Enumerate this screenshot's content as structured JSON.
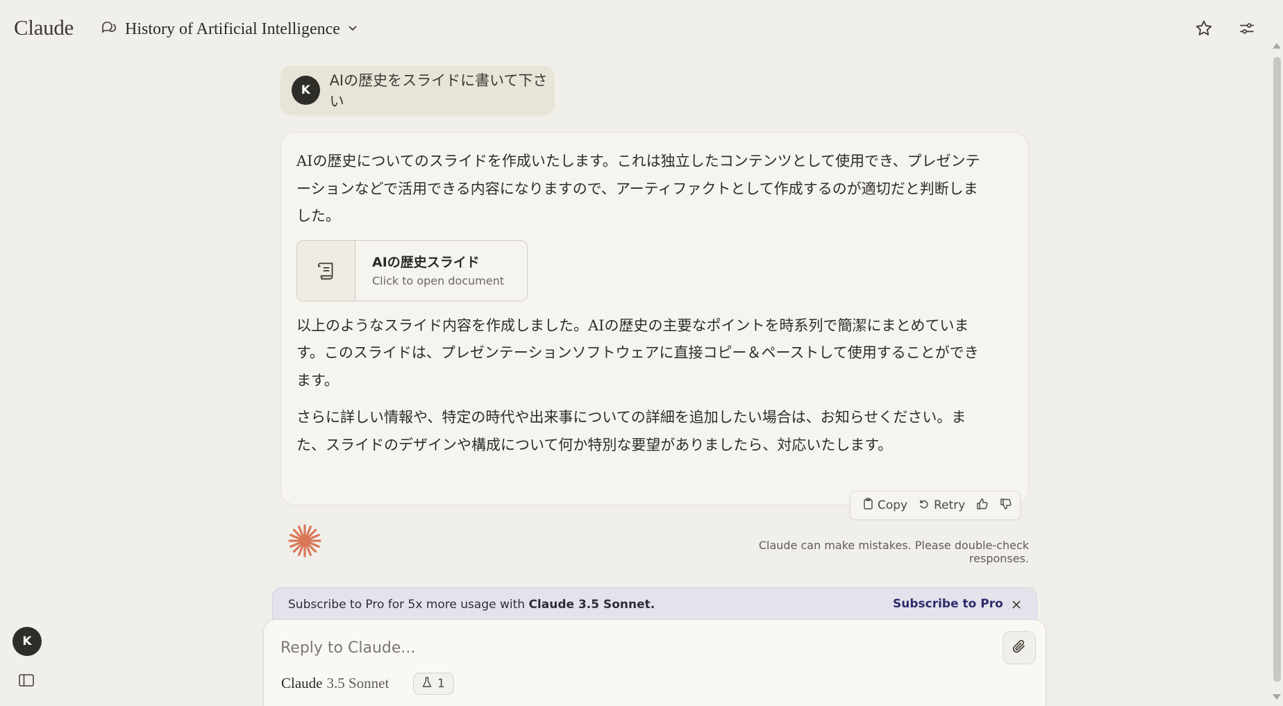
{
  "header": {
    "logo": "Claude",
    "chat_title": "History of Artificial Intelligence",
    "icons": [
      "chat-bubbles-icon",
      "chevron-down-icon",
      "star-icon",
      "sliders-icon"
    ]
  },
  "user_message": {
    "avatar_initial": "K",
    "text": "AIの歴史をスライドに書いて下さい"
  },
  "assistant_message": {
    "paragraph1": "AIの歴史についてのスライドを作成いたします。これは独立したコンテンツとして使用でき、プレゼンテーションなどで活用できる内容になりますので、アーティファクトとして作成するのが適切だと判断しました。",
    "artifact": {
      "title": "AIの歴史スライド",
      "subtitle": "Click to open document"
    },
    "paragraph2": "以上のようなスライド内容を作成しました。AIの歴史の主要なポイントを時系列で簡潔にまとめています。このスライドは、プレゼンテーションソフトウェアに直接コピー＆ペーストして使用することができます。",
    "paragraph3": "さらに詳しい情報や、特定の時代や出来事についての詳細を追加したい場合は、お知らせください。また、スライドのデザインや構成について何か特別な要望がありましたら、対応いたします。",
    "actions": {
      "copy": "Copy",
      "retry": "Retry"
    }
  },
  "disclaimer": "Claude can make mistakes. Please double-check responses.",
  "banner": {
    "text_prefix": "Subscribe to Pro for 5x more usage with ",
    "text_bold": "Claude 3.5 Sonnet.",
    "link": "Subscribe to Pro"
  },
  "composer": {
    "placeholder": "Reply to Claude...",
    "model_name": "Claude",
    "model_version": "3.5 Sonnet",
    "project_count": "1"
  },
  "sidebar": {
    "avatar_initial": "K"
  },
  "colors": {
    "background": "#f1efe9",
    "accent_orange": "#d97757",
    "banner_link": "#2f2b6b"
  }
}
